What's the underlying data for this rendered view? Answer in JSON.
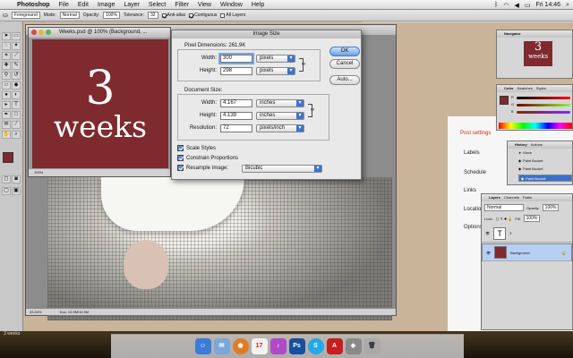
{
  "menubar": {
    "app_name": "Photoshop",
    "items": [
      "File",
      "Edit",
      "Image",
      "Layer",
      "Select",
      "Filter",
      "View",
      "Window",
      "Help"
    ],
    "clock": "Fri 14:46"
  },
  "options_bar": {
    "tool_preset": "Foreground",
    "mode_label": "Mode:",
    "mode_value": "Normal",
    "opacity_label": "Opacity:",
    "opacity_value": "100%",
    "tolerance_label": "Tolerance:",
    "tolerance_value": "32",
    "antialias_label": "Anti-alias",
    "contiguous_label": "Contiguous",
    "all_layers_label": "All Layers"
  },
  "browser_tabs": [
    "Recent",
    "Dashboard",
    "Layer Comps"
  ],
  "small_window": {
    "title": "Weeks.psd @ 100% (Background, ...",
    "art_number": "3",
    "art_word": "weeks",
    "zoom": "100%"
  },
  "doc_window": {
    "zoom": "33.33%",
    "doc_info": "Doc: 10.9M/10.9M"
  },
  "dialog": {
    "title": "Image Size",
    "pixel_dims_label": "Pixel Dimensions:",
    "pixel_dims_value": "261.9K",
    "width_label": "Width:",
    "height_label": "Height:",
    "pixel_width": "300",
    "pixel_height": "298",
    "pixels_unit": "pixels",
    "doc_size_label": "Document Size:",
    "doc_width": "4.167",
    "doc_height": "4.139",
    "inches_unit": "inches",
    "resolution_label": "Resolution:",
    "resolution_value": "72",
    "resolution_unit": "pixels/inch",
    "ok_label": "OK",
    "cancel_label": "Cancel",
    "auto_label": "Auto...",
    "scale_styles": "Scale Styles",
    "constrain": "Constrain Proportions",
    "resample": "Resample Image:",
    "resample_method": "Bicubic"
  },
  "navigator": {
    "tab": "Navigator",
    "thumb_num": "3",
    "thumb_word": "weeks"
  },
  "color_palette": {
    "tabs": [
      "Color",
      "Swatches",
      "Styles"
    ],
    "r": "R",
    "g": "G",
    "b": "B"
  },
  "history": {
    "tabs": [
      "History",
      "Actions"
    ],
    "items": [
      "Move",
      "Paint Bucket",
      "Paint Bucket",
      "Paint Bucket"
    ]
  },
  "layers": {
    "tabs": [
      "Layers",
      "Channels",
      "Paths"
    ],
    "blend_mode": "Normal",
    "opacity_label": "Opacity:",
    "opacity_value": "100%",
    "lock_label": "Lock:",
    "fill_label": "Fill:",
    "fill_value": "100%",
    "type_layer": "T",
    "type_layer_name": "3",
    "bg_layer": "Background"
  },
  "wordpress": {
    "post_settings": "Post settings",
    "labels": "Labels",
    "schedule": "Schedule",
    "links": "Links",
    "location": "Location",
    "options": "Options"
  },
  "desktop_label": "3 weeks",
  "dock_icons": [
    "finder",
    "mail",
    "firefox",
    "ical",
    "itunes",
    "photoshop",
    "skype",
    "acrobat",
    "preview",
    "trash"
  ],
  "colors": {
    "canvas_red": "#7e2a2f",
    "accent_blue": "#3f73c9",
    "wp_red": "#d42a14"
  }
}
